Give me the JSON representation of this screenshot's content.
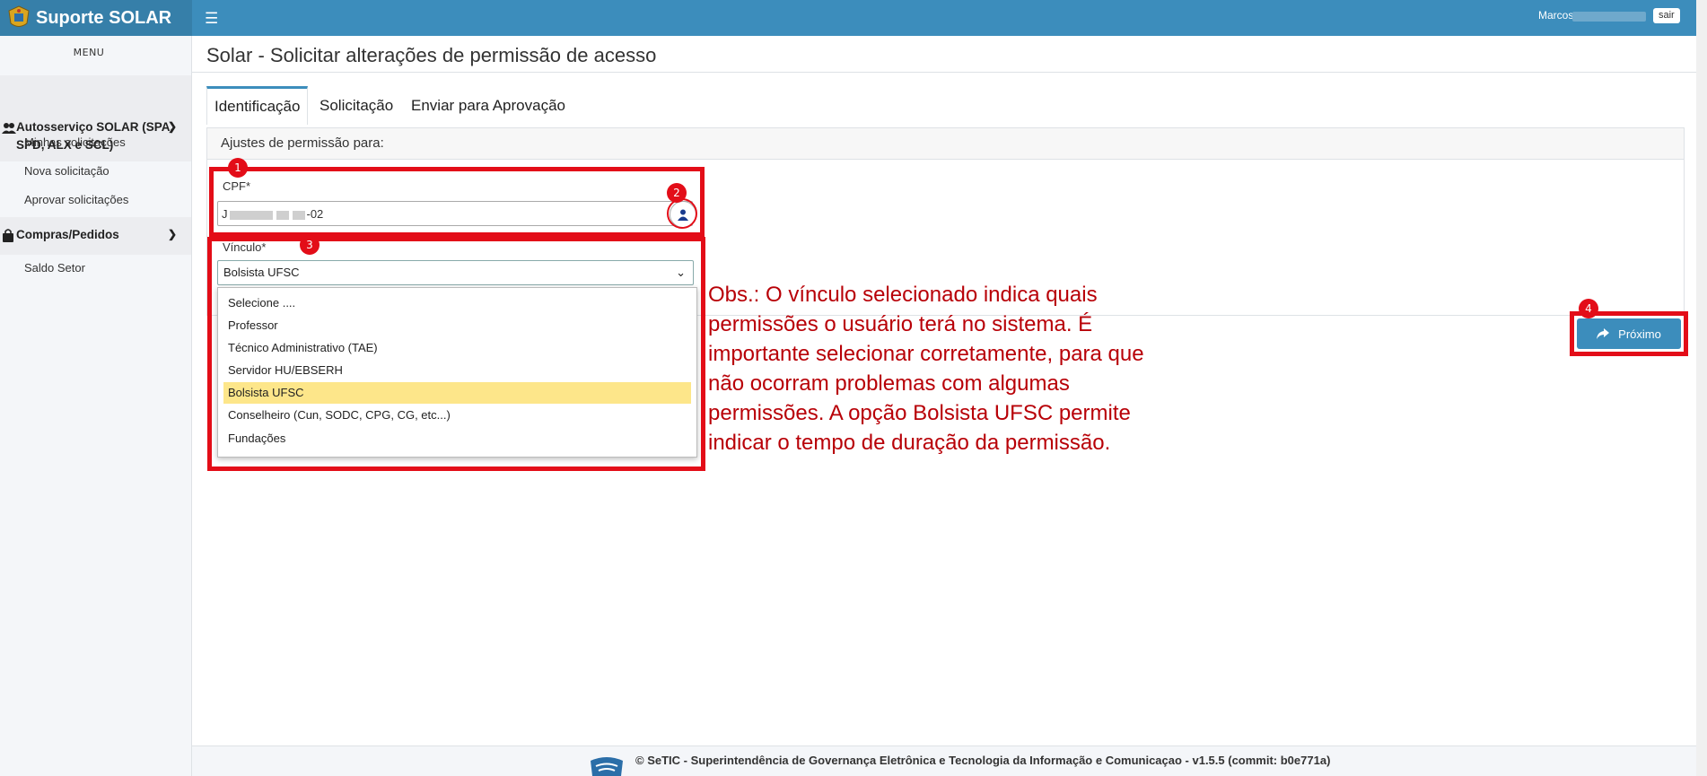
{
  "app": {
    "title": "Suporte SOLAR"
  },
  "header": {
    "user_name": "Marcos",
    "logout_label": "sair"
  },
  "sidebar": {
    "menu_label": "MENU",
    "groups": [
      {
        "label_line1": "Autosserviço SOLAR (SPA,",
        "label_line2": "SPD, ALX e SCL)",
        "icon": "users-icon",
        "items": [
          "Minhas solicitações",
          "Nova solicitação",
          "Aprovar solicitações"
        ]
      },
      {
        "label_line1": "Compras/Pedidos",
        "icon": "shopping-bag-icon",
        "items": [
          "Saldo Setor"
        ]
      }
    ]
  },
  "page": {
    "title": "Solar - Solicitar alterações de permissão de acesso",
    "tabs": [
      "Identificação",
      "Solicitação",
      "Enviar para Aprovação"
    ],
    "active_tab": "Identificação",
    "panel_header": "Ajustes de permissão para:",
    "cpf": {
      "label": "CPF*",
      "value_prefix": "J",
      "value_suffix": "-02"
    },
    "vinculo": {
      "label": "Vínculo*",
      "selected": "Bolsista UFSC",
      "options": [
        "Selecione ....",
        "Professor",
        "Técnico Administrativo (TAE)",
        "Servidor HU/EBSERH",
        "Bolsista UFSC",
        "Conselheiro (Cun, SODC, CPG, CG, etc...)",
        "Fundações"
      ]
    },
    "next_label": "Próximo"
  },
  "annotations": {
    "badges": [
      "1",
      "2",
      "3",
      "4"
    ],
    "note": "Obs.: O vínculo selecionado indica quais permissões o usuário terá no sistema. É importante selecionar corretamente, para que não ocorram problemas com algumas permissões. A opção Bolsista UFSC permite indicar o tempo de duração da permissão."
  },
  "footer": {
    "text": "© SeTIC - Superintendência de Governança Eletrônica e Tecnologia da Informação e Comunicaçao - v1.5.5 (commit: b0e771a)"
  },
  "colors": {
    "primary": "#3c8dbc",
    "brand_dark": "#367fa9",
    "annotation_red": "#e30d18",
    "note_red": "#b80007",
    "selected_option": "#fde68a"
  }
}
